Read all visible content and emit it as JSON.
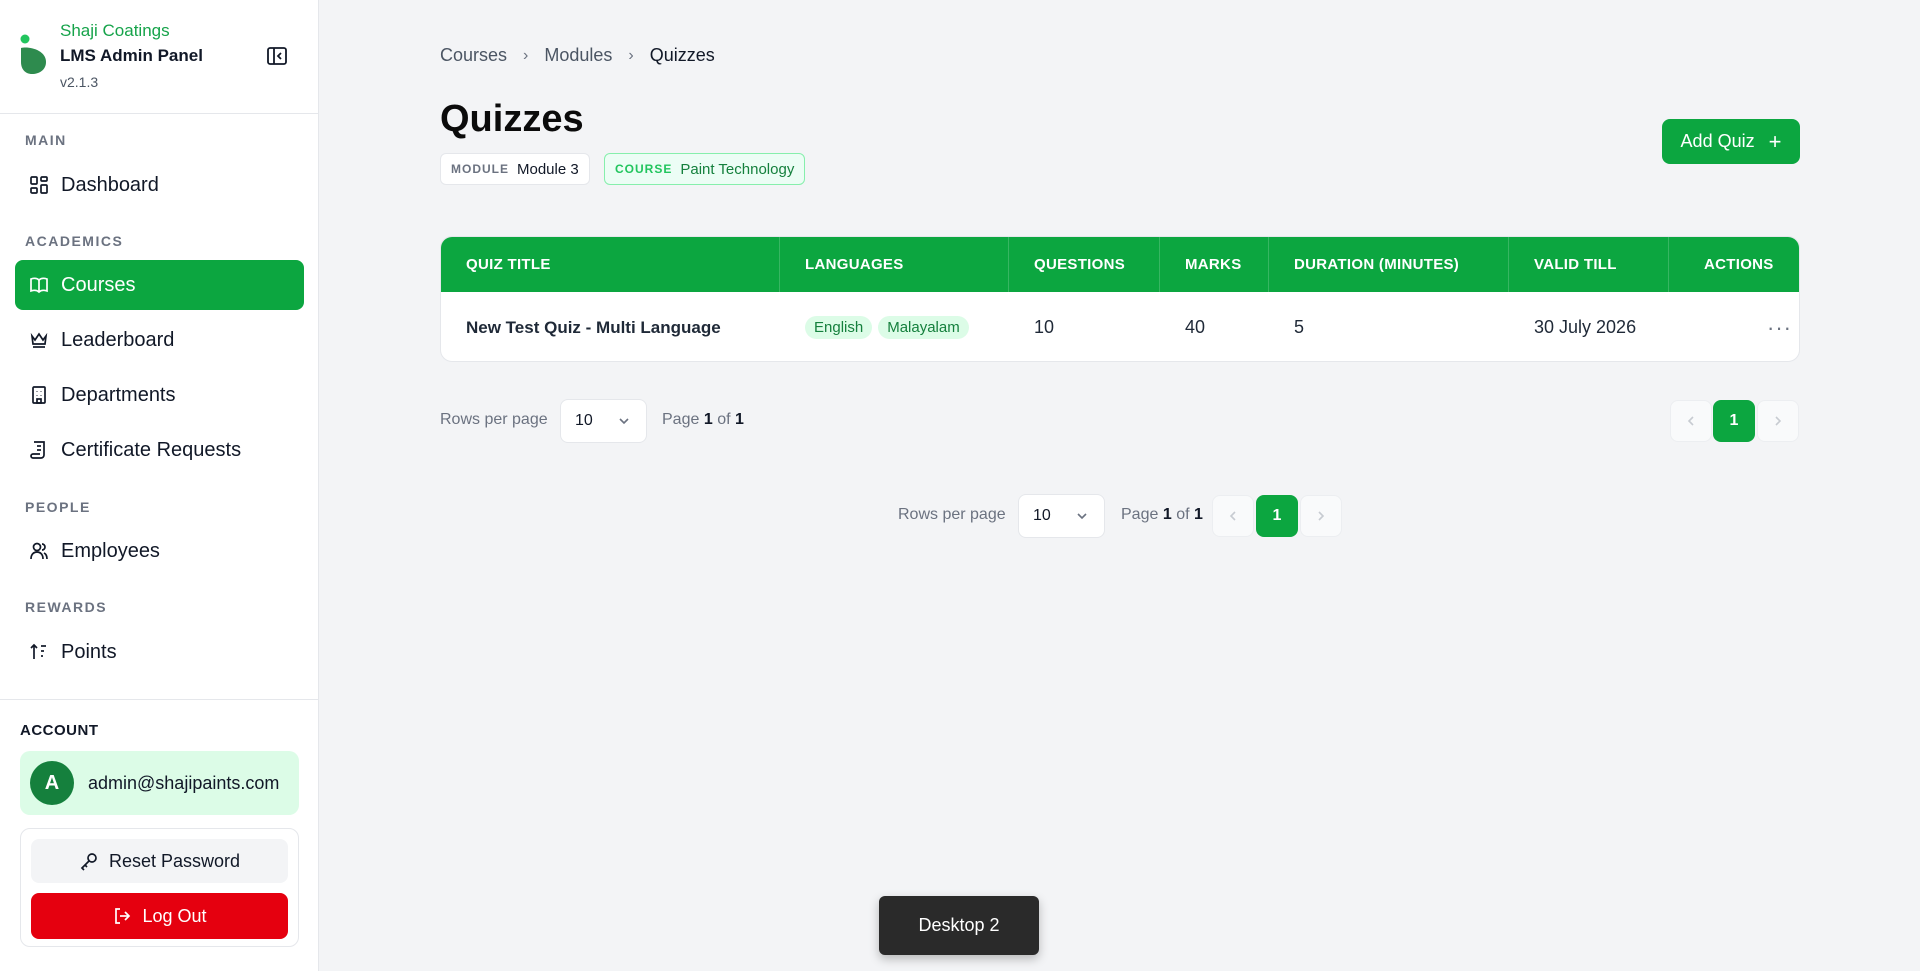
{
  "brand": {
    "name": "Shaji Coatings",
    "title": "LMS Admin Panel",
    "version": "v2.1.3"
  },
  "sidebar": {
    "sections": {
      "main": "MAIN",
      "academics": "ACADEMICS",
      "people": "PEOPLE",
      "rewards": "REWARDS"
    },
    "items": {
      "dashboard": "Dashboard",
      "courses": "Courses",
      "leaderboard": "Leaderboard",
      "departments": "Departments",
      "certificates": "Certificate Requests",
      "employees": "Employees",
      "points": "Points"
    },
    "active": "courses"
  },
  "account": {
    "label": "ACCOUNT",
    "avatar_initial": "A",
    "email": "admin@shajipaints.com",
    "reset_label": "Reset Password",
    "logout_label": "Log Out"
  },
  "breadcrumb": [
    "Courses",
    "Modules",
    "Quizzes"
  ],
  "page": {
    "title": "Quizzes",
    "module_key": "MODULE",
    "module_value": "Module 3",
    "course_key": "COURSE",
    "course_value": "Paint Technology",
    "add_label": "Add Quiz",
    "add_icon": "+"
  },
  "table": {
    "columns": [
      "QUIZ TITLE",
      "LANGUAGES",
      "QUESTIONS",
      "MARKS",
      "DURATION (MINUTES)",
      "VALID TILL",
      "ACTIONS"
    ],
    "rows": [
      {
        "title": "New Test Quiz - Multi Language",
        "languages": [
          "English",
          "Malayalam"
        ],
        "questions": "10",
        "marks": "40",
        "duration": "5",
        "valid_till": "30 July 2026",
        "actions": "···"
      }
    ]
  },
  "pagination": {
    "rows_label": "Rows per page",
    "rows_value": "10",
    "page_prefix": "Page",
    "page_current": "1",
    "page_of": "of",
    "page_total": "1",
    "current_button": "1"
  },
  "toast": {
    "label": "Desktop 2"
  },
  "colors": {
    "accent": "#0ca640",
    "danger": "#e5000f",
    "brand_text": "#16a34a"
  }
}
